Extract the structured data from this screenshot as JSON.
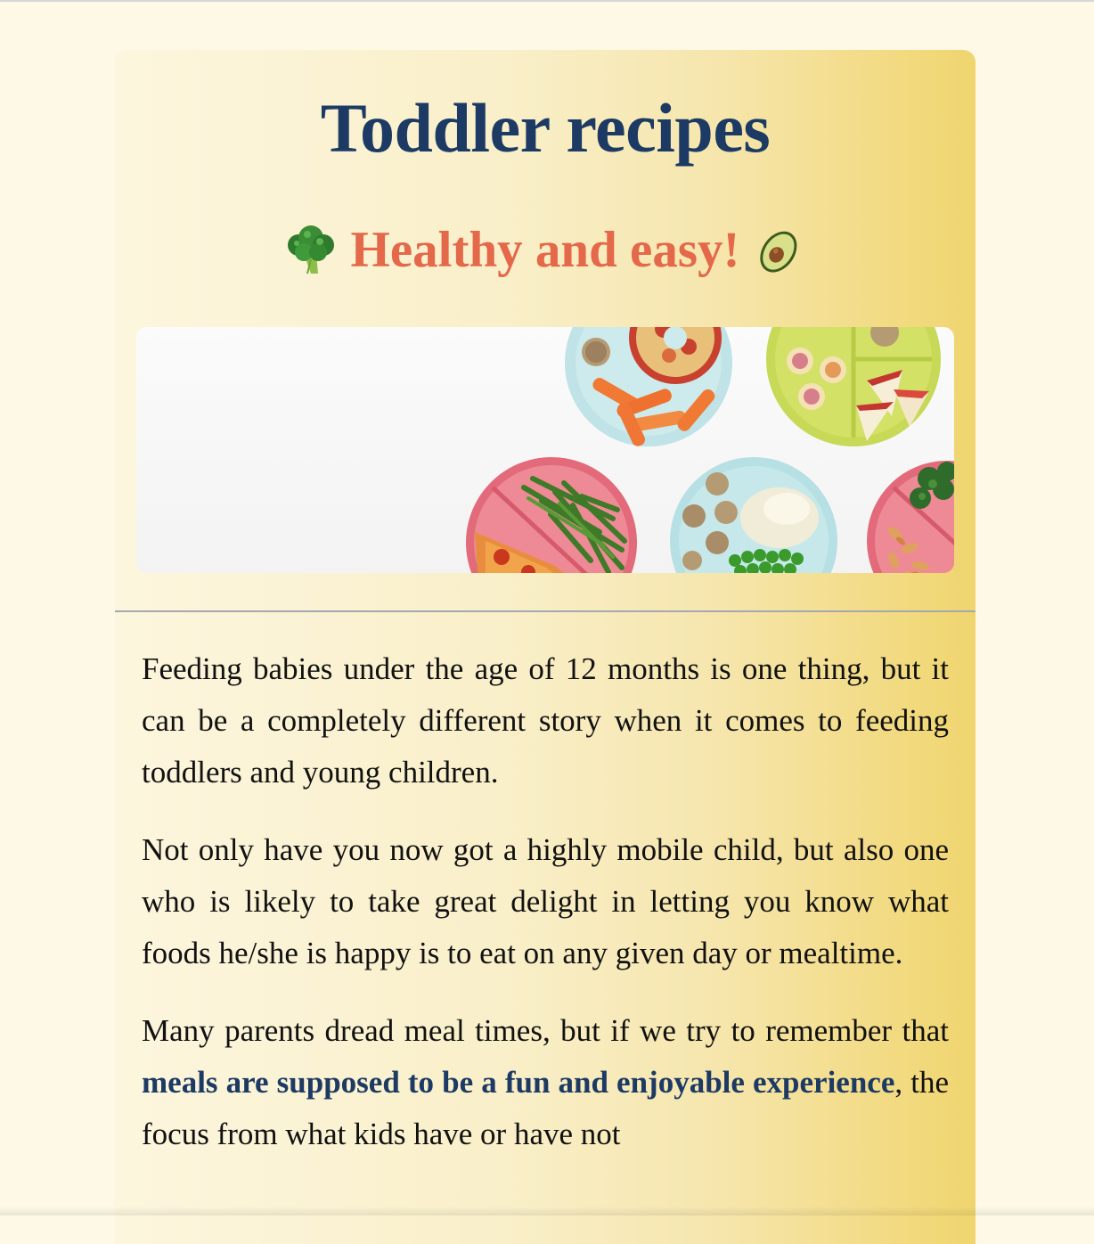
{
  "page": {
    "title": "Toddler recipes",
    "subtitle": "Healthy and easy!",
    "subtitle_icons": [
      "broccoli-icon",
      "avocado-icon"
    ],
    "hero_image": "toddler meal plates"
  },
  "article": {
    "paragraph_1": "Feeding babies under the age of 12 months is one thing, but it can be a completely different story when it comes to feeding toddlers and young children.",
    "paragraph_2": "Not only have you now got a highly mobile child, but also one who is likely to take great delight in letting you know what foods he/she is happy is to eat on any given day or mealtime.",
    "paragraph_3_start": "Many parents dread meal times, but if we try to remember that ",
    "paragraph_3_highlight": "meals are supposed to be a fun and enjoyable experience",
    "paragraph_3_end": ", the focus from what kids have or have not"
  },
  "colors": {
    "page_background": "#fdf9e6",
    "title": "#1c3a63",
    "subtitle": "#e4684a",
    "highlight": "#1c3a63",
    "card_gradient_end": "#f0d56e"
  }
}
